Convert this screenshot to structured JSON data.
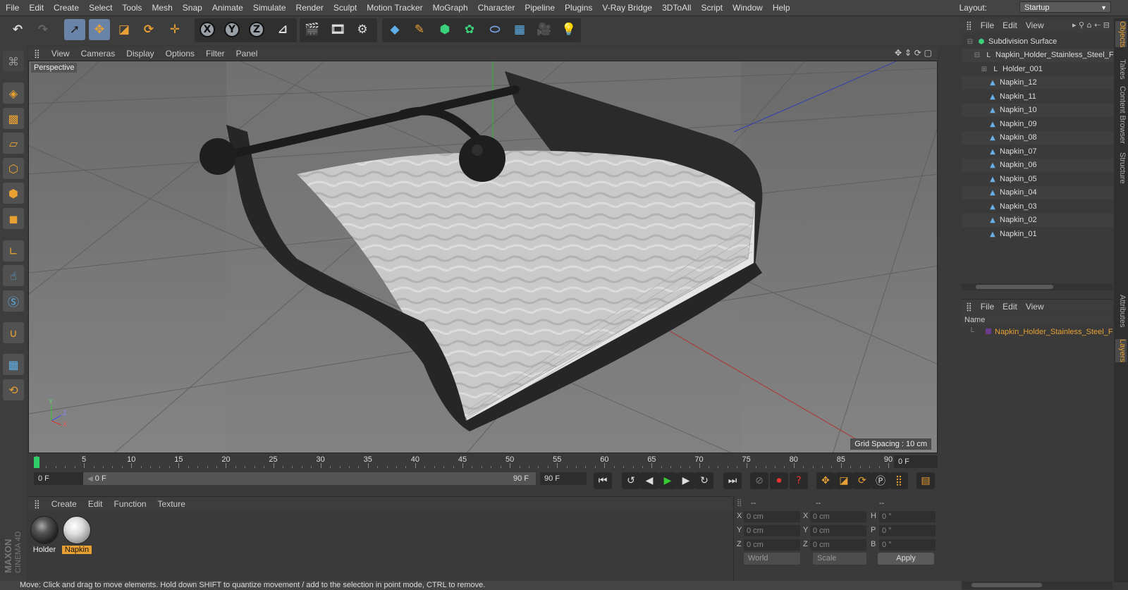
{
  "menubar": [
    "File",
    "Edit",
    "Create",
    "Select",
    "Tools",
    "Mesh",
    "Snap",
    "Animate",
    "Simulate",
    "Render",
    "Sculpt",
    "Motion Tracker",
    "MoGraph",
    "Character",
    "Pipeline",
    "Plugins",
    "V-Ray Bridge",
    "3DToAll",
    "Script",
    "Window",
    "Help"
  ],
  "layout": {
    "label": "Layout:",
    "value": "Startup"
  },
  "toolbar": {
    "axis_x": "X",
    "axis_y": "Y",
    "axis_z": "Z"
  },
  "viewport": {
    "menu": [
      "View",
      "Cameras",
      "Display",
      "Options",
      "Filter",
      "Panel"
    ],
    "camera_label": "Perspective",
    "grid_spacing": "Grid Spacing : 10 cm",
    "axis_y": "Y",
    "axis_z": "Z",
    "axis_x": "X"
  },
  "timeline": {
    "ticks": [
      "0",
      "5",
      "10",
      "15",
      "20",
      "25",
      "30",
      "35",
      "40",
      "45",
      "50",
      "55",
      "60",
      "65",
      "70",
      "75",
      "80",
      "85",
      "90"
    ],
    "frame_end": "0 F",
    "current": "0 F",
    "range_start": "0 F",
    "range_end": "90 F",
    "max": "90 F"
  },
  "materials": {
    "menu": [
      "Create",
      "Edit",
      "Function",
      "Texture"
    ],
    "items": [
      {
        "name": "Holder",
        "selected": false
      },
      {
        "name": "Napkin",
        "selected": true
      }
    ]
  },
  "coords": {
    "headers": [
      "--",
      "--",
      "--"
    ],
    "rows": [
      {
        "a": "X",
        "av": "0 cm",
        "b": "X",
        "bv": "0 cm",
        "c": "H",
        "cv": "0 °"
      },
      {
        "a": "Y",
        "av": "0 cm",
        "b": "Y",
        "bv": "0 cm",
        "c": "P",
        "cv": "0 °"
      },
      {
        "a": "Z",
        "av": "0 cm",
        "b": "Z",
        "bv": "0 cm",
        "c": "B",
        "cv": "0 °"
      }
    ],
    "mode1": "World",
    "mode2": "Scale",
    "apply": "Apply"
  },
  "objects": {
    "menu": [
      "File",
      "Edit",
      "View"
    ],
    "items": [
      {
        "name": "Subdivision Surface",
        "level": 0,
        "icon": "subdivision-icon"
      },
      {
        "name": "Napkin_Holder_Stainless_Steel_Fa",
        "level": 1,
        "icon": "null-icon"
      },
      {
        "name": "Holder_001",
        "level": 2,
        "icon": "null-icon"
      },
      {
        "name": "Napkin_12",
        "level": 2,
        "icon": "polygon-icon"
      },
      {
        "name": "Napkin_11",
        "level": 2,
        "icon": "polygon-icon"
      },
      {
        "name": "Napkin_10",
        "level": 2,
        "icon": "polygon-icon"
      },
      {
        "name": "Napkin_09",
        "level": 2,
        "icon": "polygon-icon"
      },
      {
        "name": "Napkin_08",
        "level": 2,
        "icon": "polygon-icon"
      },
      {
        "name": "Napkin_07",
        "level": 2,
        "icon": "polygon-icon"
      },
      {
        "name": "Napkin_06",
        "level": 2,
        "icon": "polygon-icon"
      },
      {
        "name": "Napkin_05",
        "level": 2,
        "icon": "polygon-icon"
      },
      {
        "name": "Napkin_04",
        "level": 2,
        "icon": "polygon-icon"
      },
      {
        "name": "Napkin_03",
        "level": 2,
        "icon": "polygon-icon"
      },
      {
        "name": "Napkin_02",
        "level": 2,
        "icon": "polygon-icon"
      },
      {
        "name": "Napkin_01",
        "level": 2,
        "icon": "polygon-icon"
      }
    ]
  },
  "layers": {
    "menu": [
      "File",
      "Edit",
      "View"
    ],
    "header": "Name",
    "row": "Napkin_Holder_Stainless_Steel_Fu"
  },
  "sidetabs": [
    "Objects",
    "Takes",
    "Content Browser",
    "Structure",
    "Attributes",
    "Layers"
  ],
  "status": "Move: Click and drag to move elements. Hold down SHIFT to quantize movement / add to the selection in point mode, CTRL to remove.",
  "brand": {
    "top": "MAXON",
    "bottom": "CINEMA 4D"
  },
  "colors": {
    "accent": "#e8a033",
    "selection": "#6a84a8",
    "panel": "#3a3a3a"
  }
}
